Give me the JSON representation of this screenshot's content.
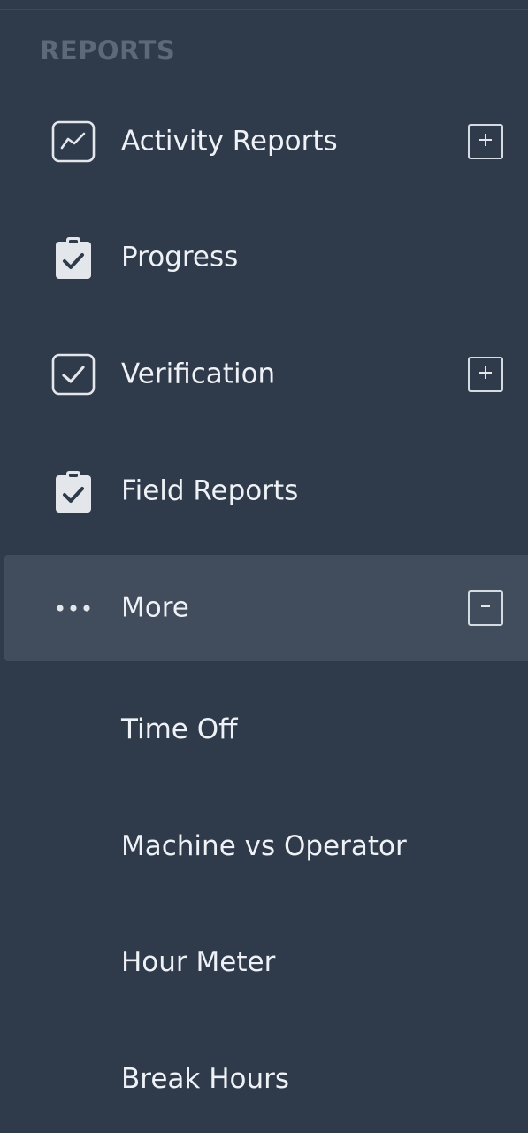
{
  "section_title": "REPORTS",
  "nav": {
    "activity_reports": {
      "label": "Activity Reports",
      "icon": "line-chart-icon"
    },
    "progress": {
      "label": "Progress",
      "icon": "clipboard-check-icon"
    },
    "verification": {
      "label": "Verification",
      "icon": "checkbox-icon"
    },
    "field_reports": {
      "label": "Field Reports",
      "icon": "clipboard-check-icon"
    },
    "more": {
      "label": "More",
      "icon": "ellipsis-icon"
    }
  },
  "sub_items": [
    "Time Off",
    "Machine vs Operator",
    "Hour Meter",
    "Break Hours"
  ],
  "colors": {
    "background": "#2f3a4b",
    "active_background": "#414c5c",
    "section_title": "#5d6979",
    "text": "#eef1f5"
  }
}
